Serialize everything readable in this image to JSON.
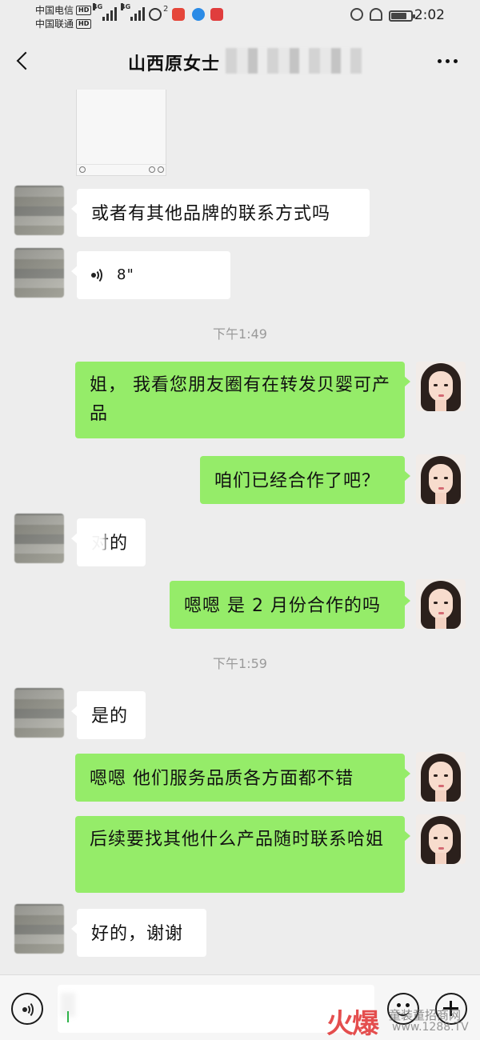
{
  "status_bar": {
    "carrier_1": "中国电信",
    "carrier_2": "中国联通",
    "hd_badge": "HD",
    "network_1": "4G",
    "network_2": "4G",
    "hotspot_count": "2",
    "battery_level": 0.8,
    "time": "2:02",
    "icons": [
      "huawei-app-icon",
      "messenger-icon",
      "reader-icon",
      "alarm-icon",
      "mute-icon",
      "battery-icon"
    ]
  },
  "header": {
    "title": "山西原女士"
  },
  "messages": [
    {
      "type": "image",
      "side": "left"
    },
    {
      "type": "text",
      "side": "left",
      "text": "或者有其他品牌的联系方式吗"
    },
    {
      "type": "voice",
      "side": "left",
      "duration": "8\""
    },
    {
      "type": "timestamp",
      "text": "下午1:49"
    },
    {
      "type": "text",
      "side": "right",
      "text": "姐，  我看您朋友圈有在转发贝婴可产品"
    },
    {
      "type": "text",
      "side": "right",
      "text": "咱们已经合作了吧？"
    },
    {
      "type": "text",
      "side": "left",
      "text": "对的"
    },
    {
      "type": "text",
      "side": "right",
      "text": "嗯嗯 是 2 月份合作的吗"
    },
    {
      "type": "timestamp",
      "text": "下午1:59"
    },
    {
      "type": "text",
      "side": "left",
      "text": "是的"
    },
    {
      "type": "text",
      "side": "right",
      "text": "嗯嗯 他们服务品质各方面都不错"
    },
    {
      "type": "text",
      "side": "right",
      "text": "后续要找其他什么产品随时联系哈姐"
    },
    {
      "type": "text",
      "side": "left",
      "text": "好的，谢谢"
    }
  ],
  "watermark": {
    "brand": "火爆",
    "sub": "童装童招商网",
    "url": "www.1288.TV"
  },
  "colors": {
    "background": "#ededed",
    "bubble_self": "#95ec69",
    "bubble_other": "#ffffff",
    "timestamp": "#9a9a9a",
    "watermark": "#e23b3b"
  }
}
